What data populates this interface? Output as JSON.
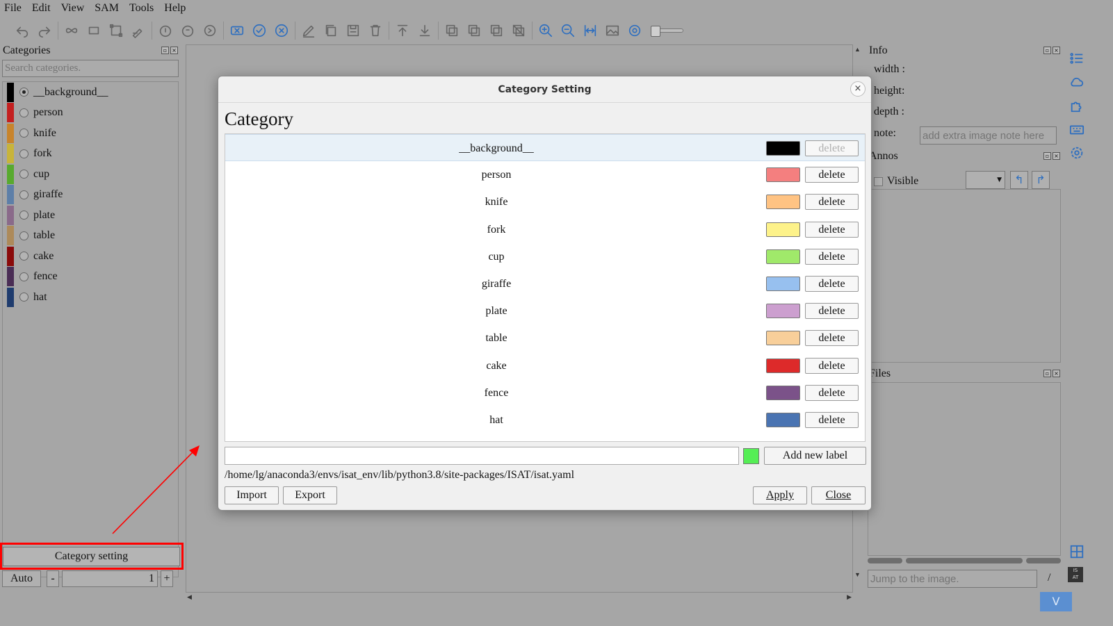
{
  "menu": [
    "File",
    "Edit",
    "View",
    "SAM",
    "Tools",
    "Help"
  ],
  "left": {
    "title": "Categories",
    "search_placeholder": "Search categories.",
    "categories": [
      {
        "name": "__background__",
        "color": "#000000",
        "checked": true
      },
      {
        "name": "person",
        "color": "#c42020",
        "checked": false
      },
      {
        "name": "knife",
        "color": "#c8842c",
        "checked": false
      },
      {
        "name": "fork",
        "color": "#c8b43a",
        "checked": false
      },
      {
        "name": "cup",
        "color": "#58aa2e",
        "checked": false
      },
      {
        "name": "giraffe",
        "color": "#5d7fa8",
        "checked": false
      },
      {
        "name": "plate",
        "color": "#8a6a8a",
        "checked": false
      },
      {
        "name": "table",
        "color": "#ad8a5a",
        "checked": false
      },
      {
        "name": "cake",
        "color": "#8a0a0a",
        "checked": false
      },
      {
        "name": "fence",
        "color": "#4a2d55",
        "checked": false
      },
      {
        "name": "hat",
        "color": "#1f3c6e",
        "checked": false
      }
    ],
    "category_setting": "Category setting",
    "auto": "Auto",
    "minus": "-",
    "value": "1",
    "plus": "+"
  },
  "right": {
    "info_title": "Info",
    "width": "width :",
    "height": "height:",
    "depth": "depth :",
    "note": "note:",
    "note_placeholder": "add extra image note here",
    "annos_title": "Annos",
    "visible": "Visible",
    "files_title": "Files",
    "jump_placeholder": "Jump to the image.",
    "slash": "/",
    "v_button": "V"
  },
  "dialog": {
    "title": "Category Setting",
    "close_x": "×",
    "heading": "Category",
    "rows": [
      {
        "name": "__background__",
        "color": "#000000",
        "delete": "delete",
        "disabled": true
      },
      {
        "name": "person",
        "color": "#f47f7f",
        "delete": "delete",
        "disabled": false
      },
      {
        "name": "knife",
        "color": "#ffc383",
        "delete": "delete",
        "disabled": false
      },
      {
        "name": "fork",
        "color": "#fdf28a",
        "delete": "delete",
        "disabled": false
      },
      {
        "name": "cup",
        "color": "#a0e96a",
        "delete": "delete",
        "disabled": false
      },
      {
        "name": "giraffe",
        "color": "#97c0ef",
        "delete": "delete",
        "disabled": false
      },
      {
        "name": "plate",
        "color": "#cc9fcf",
        "delete": "delete",
        "disabled": false
      },
      {
        "name": "table",
        "color": "#f8cf9a",
        "delete": "delete",
        "disabled": false
      },
      {
        "name": "cake",
        "color": "#dd2a2a",
        "delete": "delete",
        "disabled": false
      },
      {
        "name": "fence",
        "color": "#7b5289",
        "delete": "delete",
        "disabled": false
      },
      {
        "name": "hat",
        "color": "#4a74b2",
        "delete": "delete",
        "disabled": false
      }
    ],
    "new_label_color": "#55ee55",
    "add_new_label": "Add new label",
    "path": "/home/lg/anaconda3/envs/isat_env/lib/python3.8/site-packages/ISAT/isat.yaml",
    "import": "Import",
    "export": "Export",
    "apply": "Apply",
    "close": "Close"
  },
  "toolbar_icons": [
    "undo-icon",
    "redo-icon",
    "polygon-icon",
    "rectangle-icon",
    "bbox-icon",
    "draw-icon",
    "rotate-left-icon",
    "rotate-right-icon",
    "repeat-icon",
    "cancel-icon",
    "finish-icon",
    "cancel-circle-icon",
    "edit-icon",
    "copy-icon",
    "save-icon",
    "delete-icon",
    "to-top-icon",
    "to-bottom-icon",
    "layer-a-icon",
    "layer-b-icon",
    "layer-c-icon",
    "layer-d-icon",
    "zoom-in-icon",
    "zoom-out-icon",
    "fit-icon",
    "image-icon",
    "eye-icon"
  ]
}
